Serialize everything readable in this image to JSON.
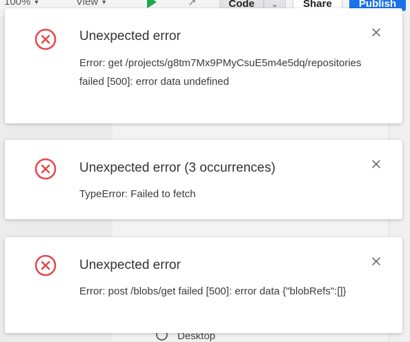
{
  "toolbar": {
    "zoom": "100%",
    "view_label": "View",
    "code_label": "Code",
    "share_label": "Share",
    "publish_label": "Publish"
  },
  "sidebar": {
    "desktop_label": "Desktop"
  },
  "colors": {
    "error_red": "#e5484d",
    "publish_blue": "#1a73e8",
    "play_green": "#1aa84b"
  },
  "icons": {
    "error": "error-circle-x-icon",
    "close": "close-icon"
  },
  "toasts": [
    {
      "title": "Unexpected error",
      "message": "Error: get /projects/g8tm7Mx9PMyCsuE5m4e5dq/repositories failed [500]: error data undefined"
    },
    {
      "title": "Unexpected error (3 occurrences)",
      "message": "TypeError: Failed to fetch"
    },
    {
      "title": "Unexpected error",
      "message": "Error: post /blobs/get failed [500]: error data {\"blobRefs\":[]}"
    }
  ]
}
